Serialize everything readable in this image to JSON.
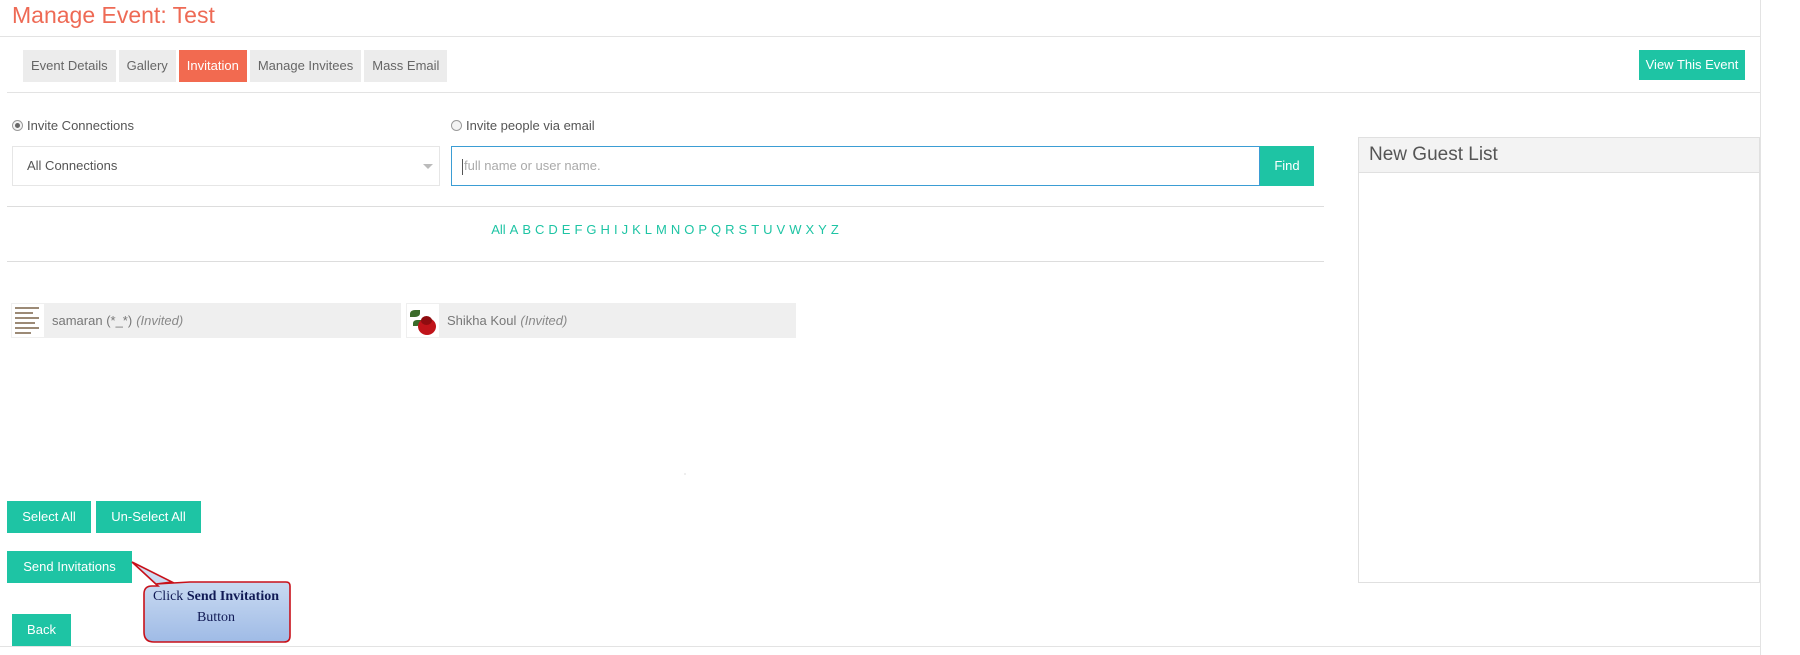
{
  "page": {
    "title": "Manage Event: Test"
  },
  "tabs": [
    {
      "label": "Event Details",
      "active": false
    },
    {
      "label": "Gallery",
      "active": false
    },
    {
      "label": "Invitation",
      "active": true
    },
    {
      "label": "Manage Invitees",
      "active": false
    },
    {
      "label": "Mass Email",
      "active": false
    }
  ],
  "header": {
    "view_event_label": "View This Event"
  },
  "invite": {
    "connections_radio_label": "Invite Connections",
    "connections_selected": true,
    "email_radio_label": "Invite people via email",
    "email_selected": false,
    "connections_select_value": "All Connections",
    "search_placeholder": "full name or user name.",
    "find_label": "Find"
  },
  "letters": [
    "All",
    "A",
    "B",
    "C",
    "D",
    "E",
    "F",
    "G",
    "H",
    "I",
    "J",
    "K",
    "L",
    "M",
    "N",
    "O",
    "P",
    "Q",
    "R",
    "S",
    "T",
    "U",
    "V",
    "W",
    "X",
    "Y",
    "Z"
  ],
  "connections": [
    {
      "name": "samaran (*_*)",
      "status": "(Invited)",
      "avatar": "list-thumbnail-icon"
    },
    {
      "name": "Shikha Koul",
      "status": "(Invited)",
      "avatar": "rose-icon"
    }
  ],
  "actions": {
    "select_all_label": "Select All",
    "unselect_all_label": "Un-Select All",
    "send_label": "Send Invitations",
    "back_label": "Back"
  },
  "callout": {
    "prefix": "Click ",
    "bold": "Send Invitation",
    "suffix": " Button"
  },
  "guest_list": {
    "title": "New Guest List"
  },
  "colors": {
    "accent": "#1ec4a4",
    "active_tab": "#f26a50",
    "title": "#ee6a55"
  }
}
